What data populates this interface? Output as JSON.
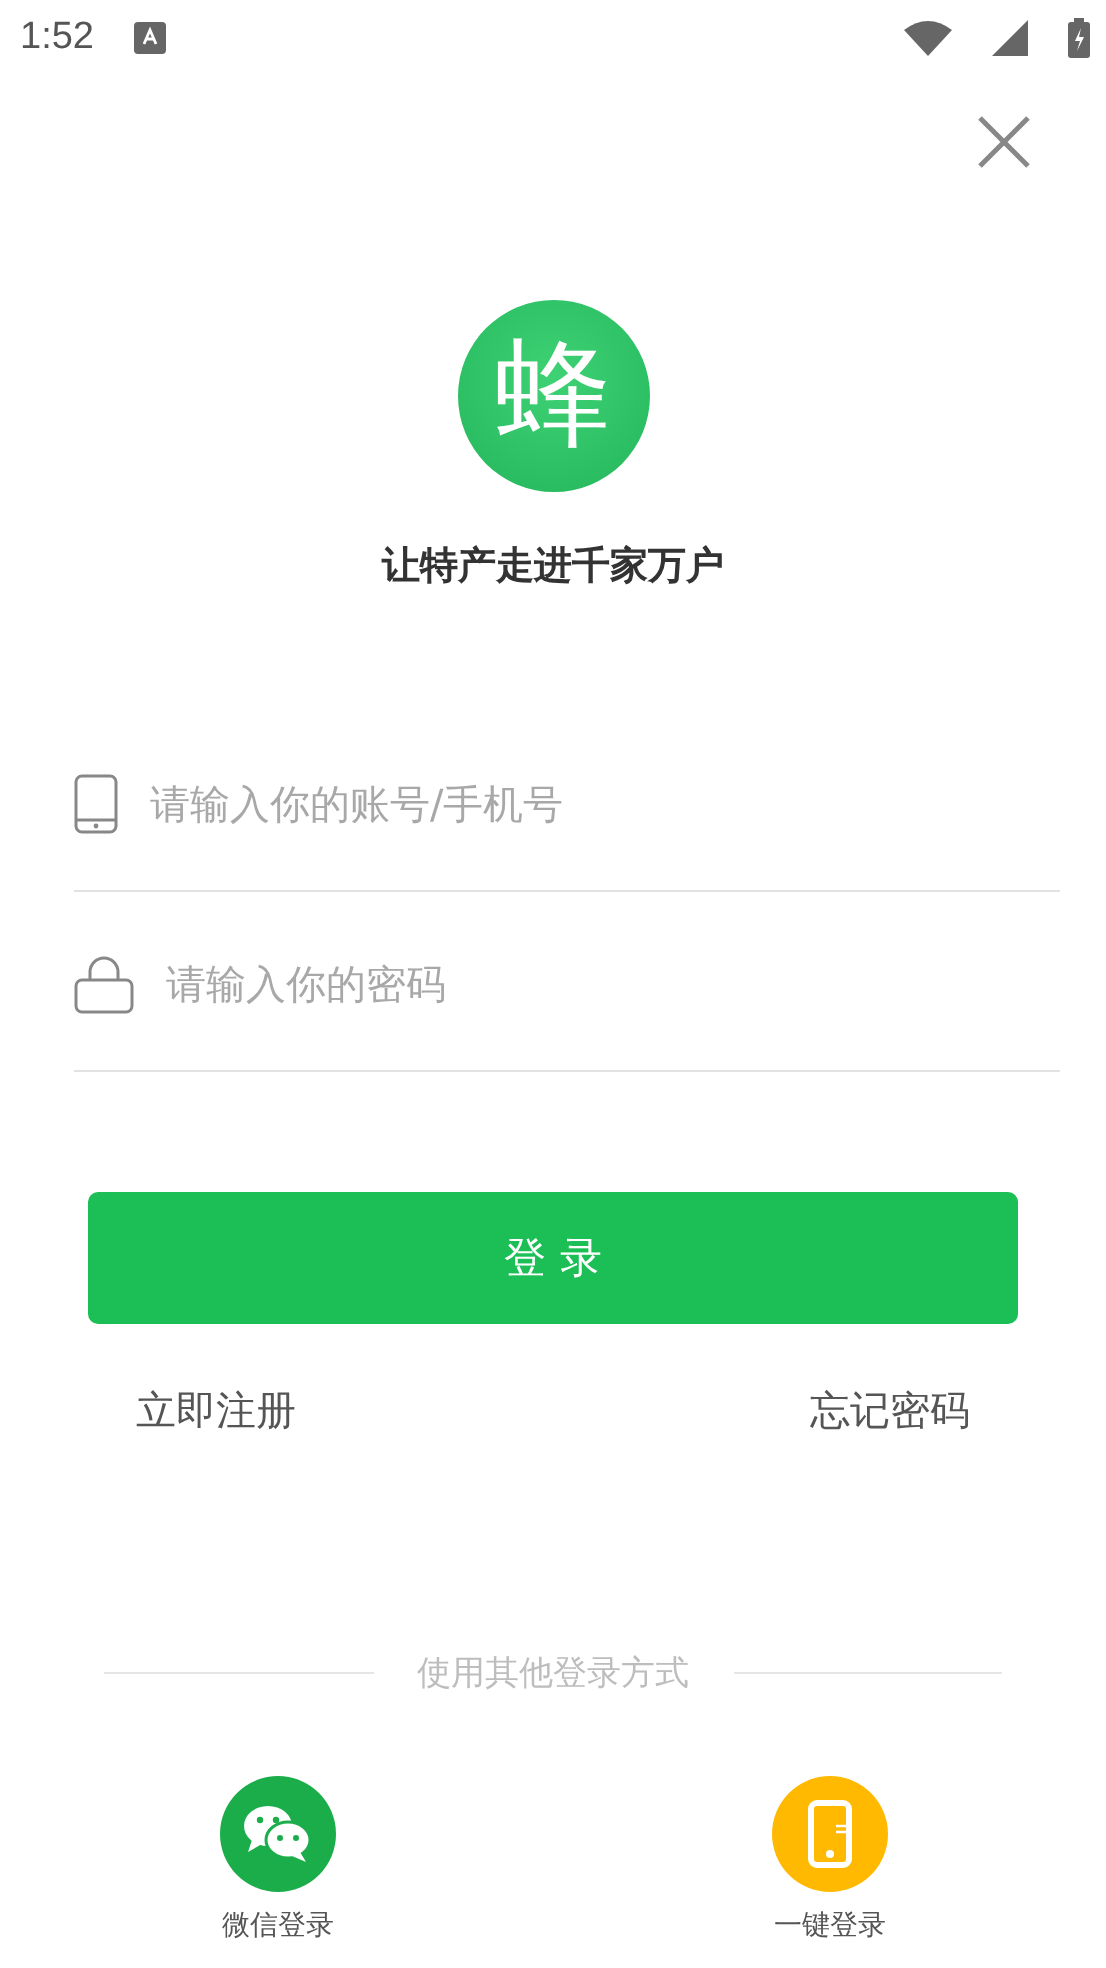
{
  "status_bar": {
    "time": "1:52"
  },
  "logo": {
    "glyph": "蜂"
  },
  "tagline": "让特产走进千家万户",
  "fields": [
    {
      "kind": "phone",
      "placeholder": "请输入你的账号/手机号"
    },
    {
      "kind": "lock",
      "placeholder": "请输入你的密码"
    }
  ],
  "login_button": "登 录",
  "links": [
    "立即注册",
    "忘记密码"
  ],
  "other_methods": {
    "label": "使用其他登录方式",
    "items": [
      {
        "kind": "wechat",
        "label": "微信登录"
      },
      {
        "kind": "phone",
        "label": "一键登录"
      }
    ]
  }
}
